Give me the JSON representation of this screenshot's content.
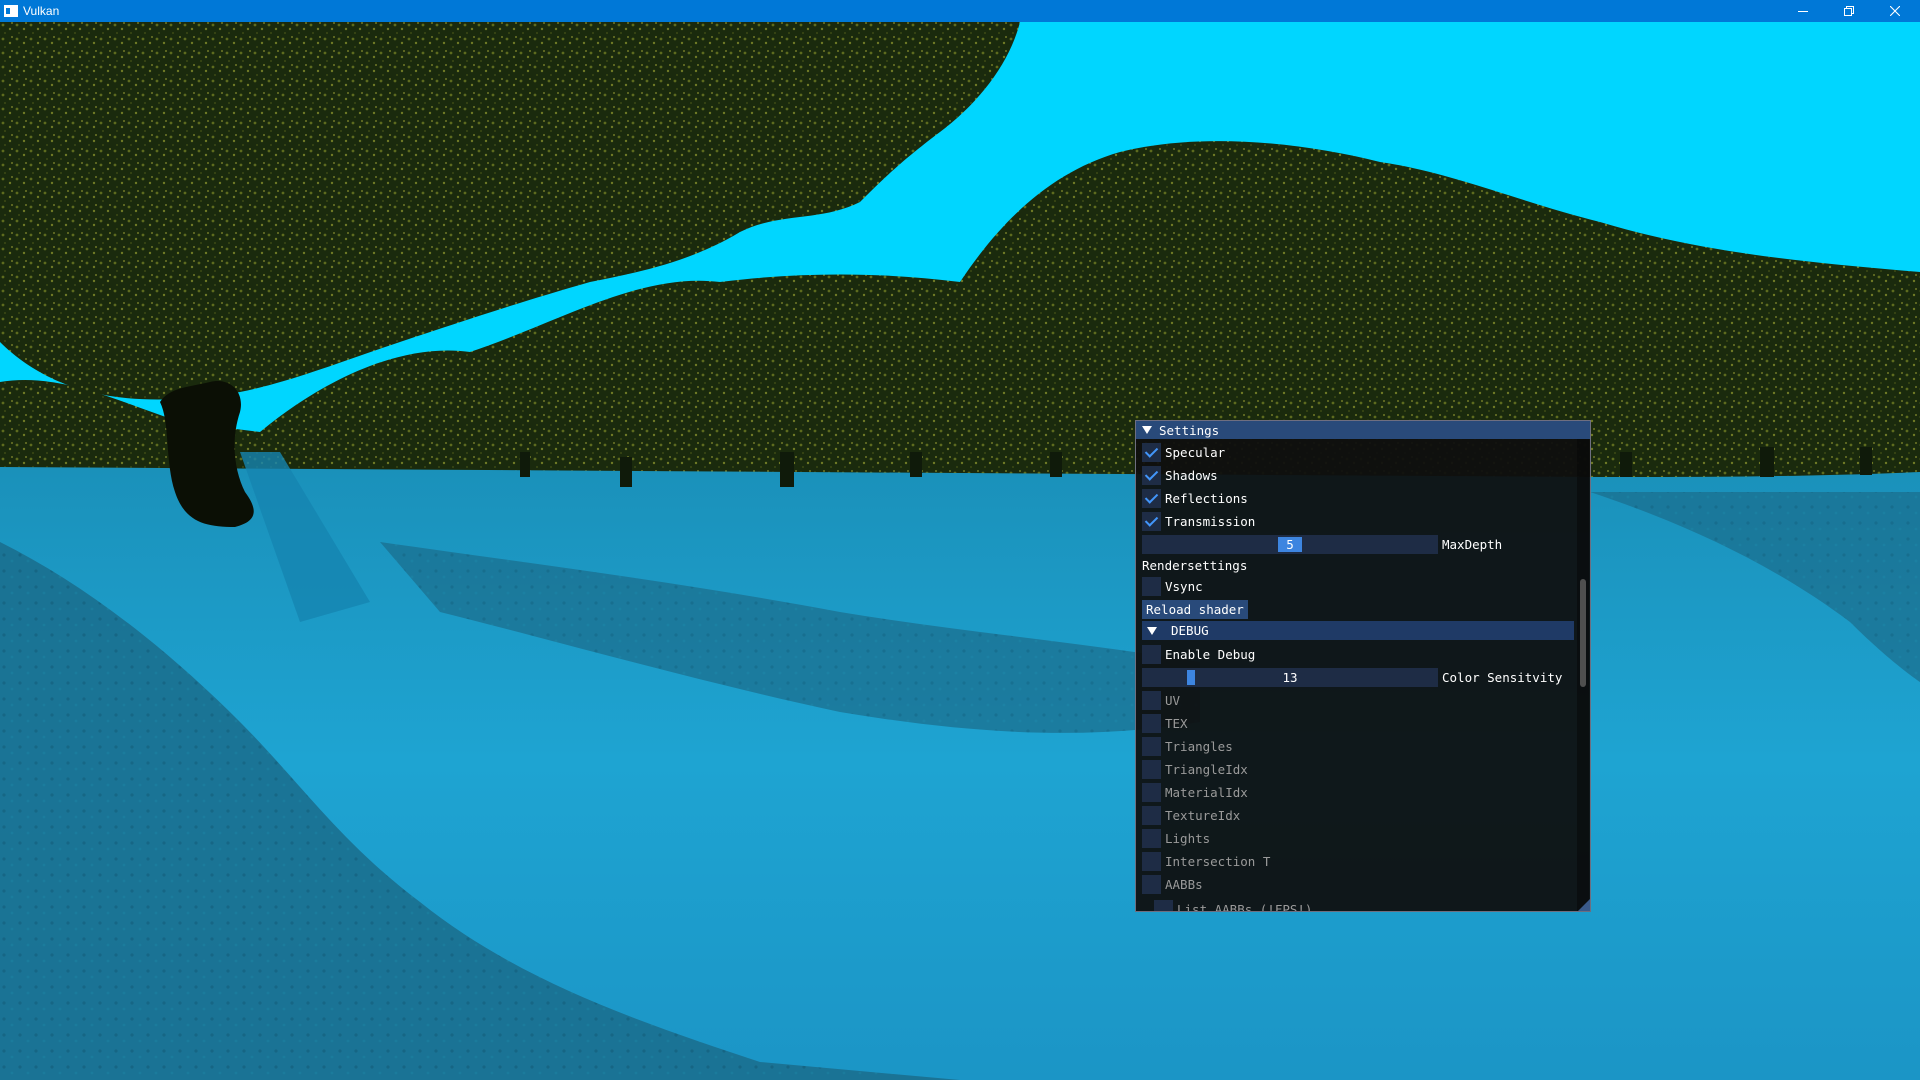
{
  "window": {
    "title": "Vulkan"
  },
  "titlebar": {
    "minimize_icon": "minimize-icon",
    "maximize_icon": "restore-icon",
    "close_icon": "close-icon"
  },
  "scene": {
    "sky_color": "#00d6ff",
    "water_color": "#1a9fcd",
    "foliage_color": "#1b2a0e"
  },
  "settings": {
    "title": "Settings",
    "specular": {
      "label": "Specular",
      "checked": true
    },
    "shadows": {
      "label": "Shadows",
      "checked": true
    },
    "reflections": {
      "label": "Reflections",
      "checked": true
    },
    "transmission": {
      "label": "Transmission",
      "checked": true
    },
    "max_depth": {
      "label": "MaxDepth",
      "value": "5",
      "fraction": 0.5
    },
    "rendersettings_label": "Rendersettings",
    "vsync": {
      "label": "Vsync",
      "checked": false
    },
    "reload_shader_label": "Reload shader",
    "debug": {
      "header": "DEBUG",
      "enable_debug": {
        "label": "Enable Debug",
        "checked": false
      },
      "color_sensitivity": {
        "label": "Color Sensitvity",
        "value": "13",
        "fraction": 0.15
      },
      "options": [
        {
          "label": "UV",
          "checked": false
        },
        {
          "label": "TEX",
          "checked": false
        },
        {
          "label": "Triangles",
          "checked": false
        },
        {
          "label": "TriangleIdx",
          "checked": false
        },
        {
          "label": "MaterialIdx",
          "checked": false
        },
        {
          "label": "TextureIdx",
          "checked": false
        },
        {
          "label": "Lights",
          "checked": false
        },
        {
          "label": "Intersection T",
          "checked": false
        },
        {
          "label": "AABBs",
          "checked": false
        }
      ],
      "list_aabbs": {
        "label": "List AABBs (!FPS!)",
        "checked": false
      }
    }
  }
}
